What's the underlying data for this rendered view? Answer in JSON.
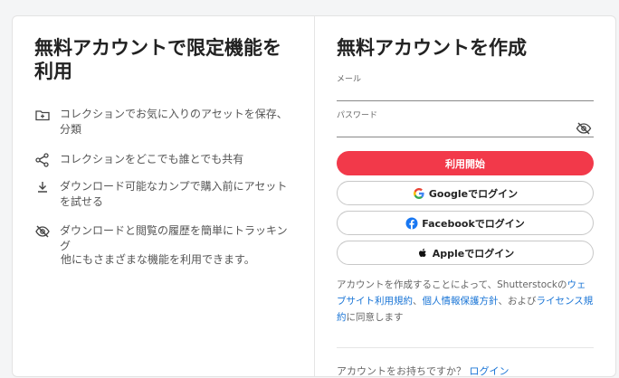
{
  "left": {
    "title": "無料アカウントで限定機能を利用",
    "features": [
      {
        "icon": "folder-plus-icon",
        "text": "コレクションでお気に入りのアセットを保存、分類"
      },
      {
        "icon": "share-icon",
        "text": "コレクションをどこでも誰とでも共有"
      },
      {
        "icon": "download-icon",
        "text": "ダウンロード可能なカンプで購入前にアセットを試せる"
      },
      {
        "icon": "eye-off-icon",
        "text": "ダウンロードと閲覧の履歴を簡単にトラッキング"
      }
    ],
    "more": "他にもさまざまな機能を利用できます。"
  },
  "right": {
    "title": "無料アカウントを作成",
    "email_label": "メール",
    "email_value": "",
    "password_label": "パスワード",
    "password_value": "",
    "submit_label": "利用開始",
    "google_label": "Googleでログイン",
    "facebook_label": "Facebookでログイン",
    "apple_label": "Appleでログイン",
    "terms": {
      "part1": "アカウントを作成することによって、Shutterstockの",
      "link1": "ウェブサイト利用規約",
      "sep1": "、",
      "link2": "個人情報保護方針",
      "sep2": "、および",
      "link3": "ライセンス規約",
      "part2": "に同意します"
    },
    "signin_prompt": "アカウントをお持ちですか？",
    "signin_link": "ログイン"
  },
  "colors": {
    "primary": "#f2394a",
    "link": "#1874d6",
    "facebook": "#1877f2"
  }
}
